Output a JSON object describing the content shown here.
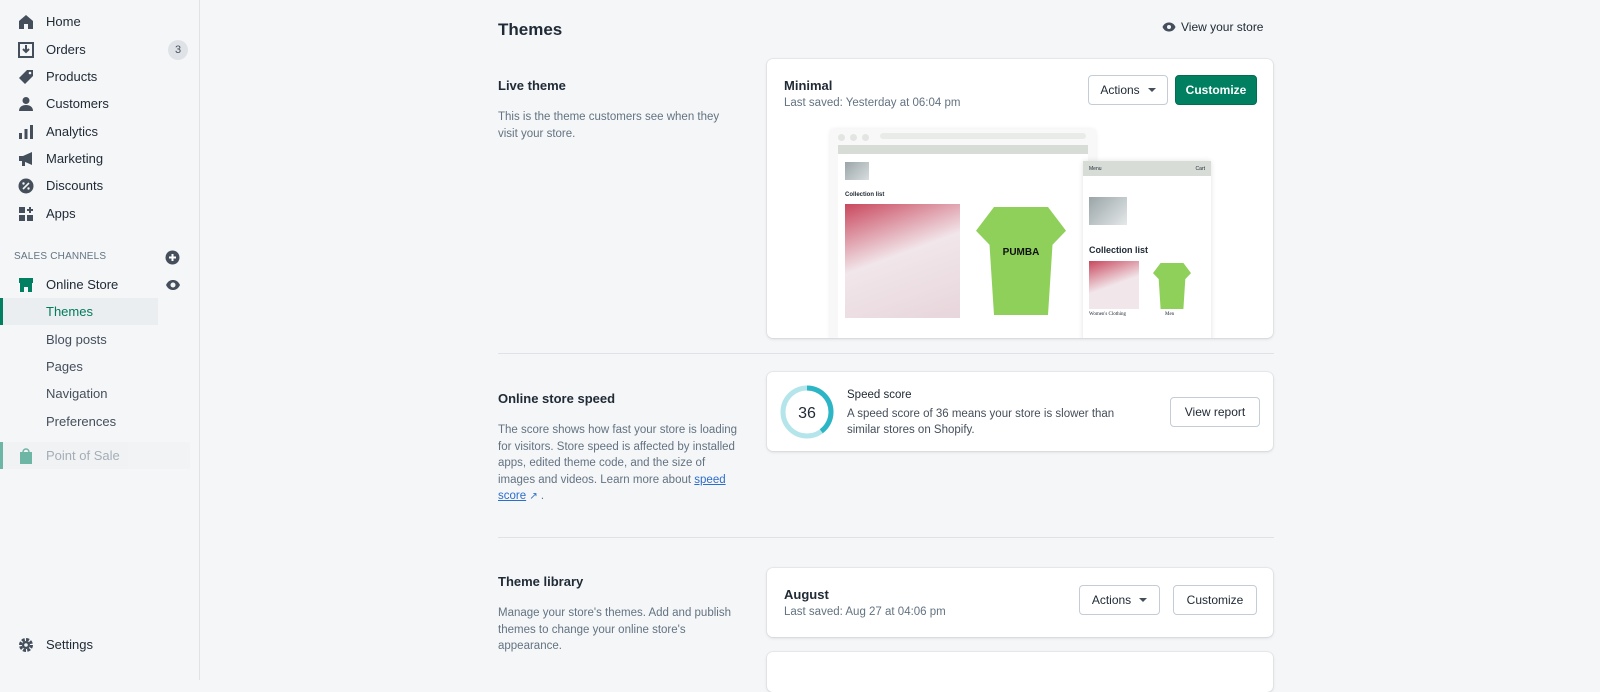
{
  "sidebar": {
    "items": [
      {
        "label": "Home",
        "icon": "home-icon"
      },
      {
        "label": "Orders",
        "icon": "orders-icon",
        "badge": "3"
      },
      {
        "label": "Products",
        "icon": "tag-icon"
      },
      {
        "label": "Customers",
        "icon": "person-icon"
      },
      {
        "label": "Analytics",
        "icon": "bar-chart-icon"
      },
      {
        "label": "Marketing",
        "icon": "megaphone-icon"
      },
      {
        "label": "Discounts",
        "icon": "discount-icon"
      },
      {
        "label": "Apps",
        "icon": "apps-icon"
      }
    ],
    "sales_channels": "SALES CHANNELS",
    "online_store": "Online Store",
    "sub_items": [
      "Themes",
      "Blog posts",
      "Pages",
      "Navigation",
      "Preferences"
    ],
    "point_of_sale": "Point of Sale",
    "settings": "Settings"
  },
  "page": {
    "title": "Themes",
    "view_store": "View your store"
  },
  "live_theme": {
    "title": "Live theme",
    "description": "This is the theme customers see when they visit your store.",
    "theme_name": "Minimal",
    "last_saved": "Last saved: Yesterday at 06:04 pm",
    "actions": "Actions",
    "customize": "Customize",
    "preview": {
      "collection_list": "Collection list",
      "menu": "Menu",
      "cart": "Cart",
      "womens": "Women's Clothing",
      "men": "Men",
      "tee_text": "PUMBA"
    }
  },
  "speed": {
    "title": "Online store speed",
    "description": "The score shows how fast your store is loading for visitors. Store speed is affected by installed apps, edited theme code, and the size of images and videos. Learn more about",
    "link": "speed score",
    "period": ".",
    "score": "36",
    "score_label": "Speed score",
    "score_text": "A speed score of 36 means your store is slower than similar stores on Shopify.",
    "view_report": "View report"
  },
  "library": {
    "title": "Theme library",
    "description": "Manage your store's themes. Add and publish themes to change your online store's appearance.",
    "theme_name": "August",
    "last_saved": "Last saved: Aug 27 at 04:06 pm",
    "actions": "Actions",
    "customize": "Customize"
  },
  "colors": {
    "accent": "#008060",
    "speed_arc": "#2cb5c5"
  }
}
